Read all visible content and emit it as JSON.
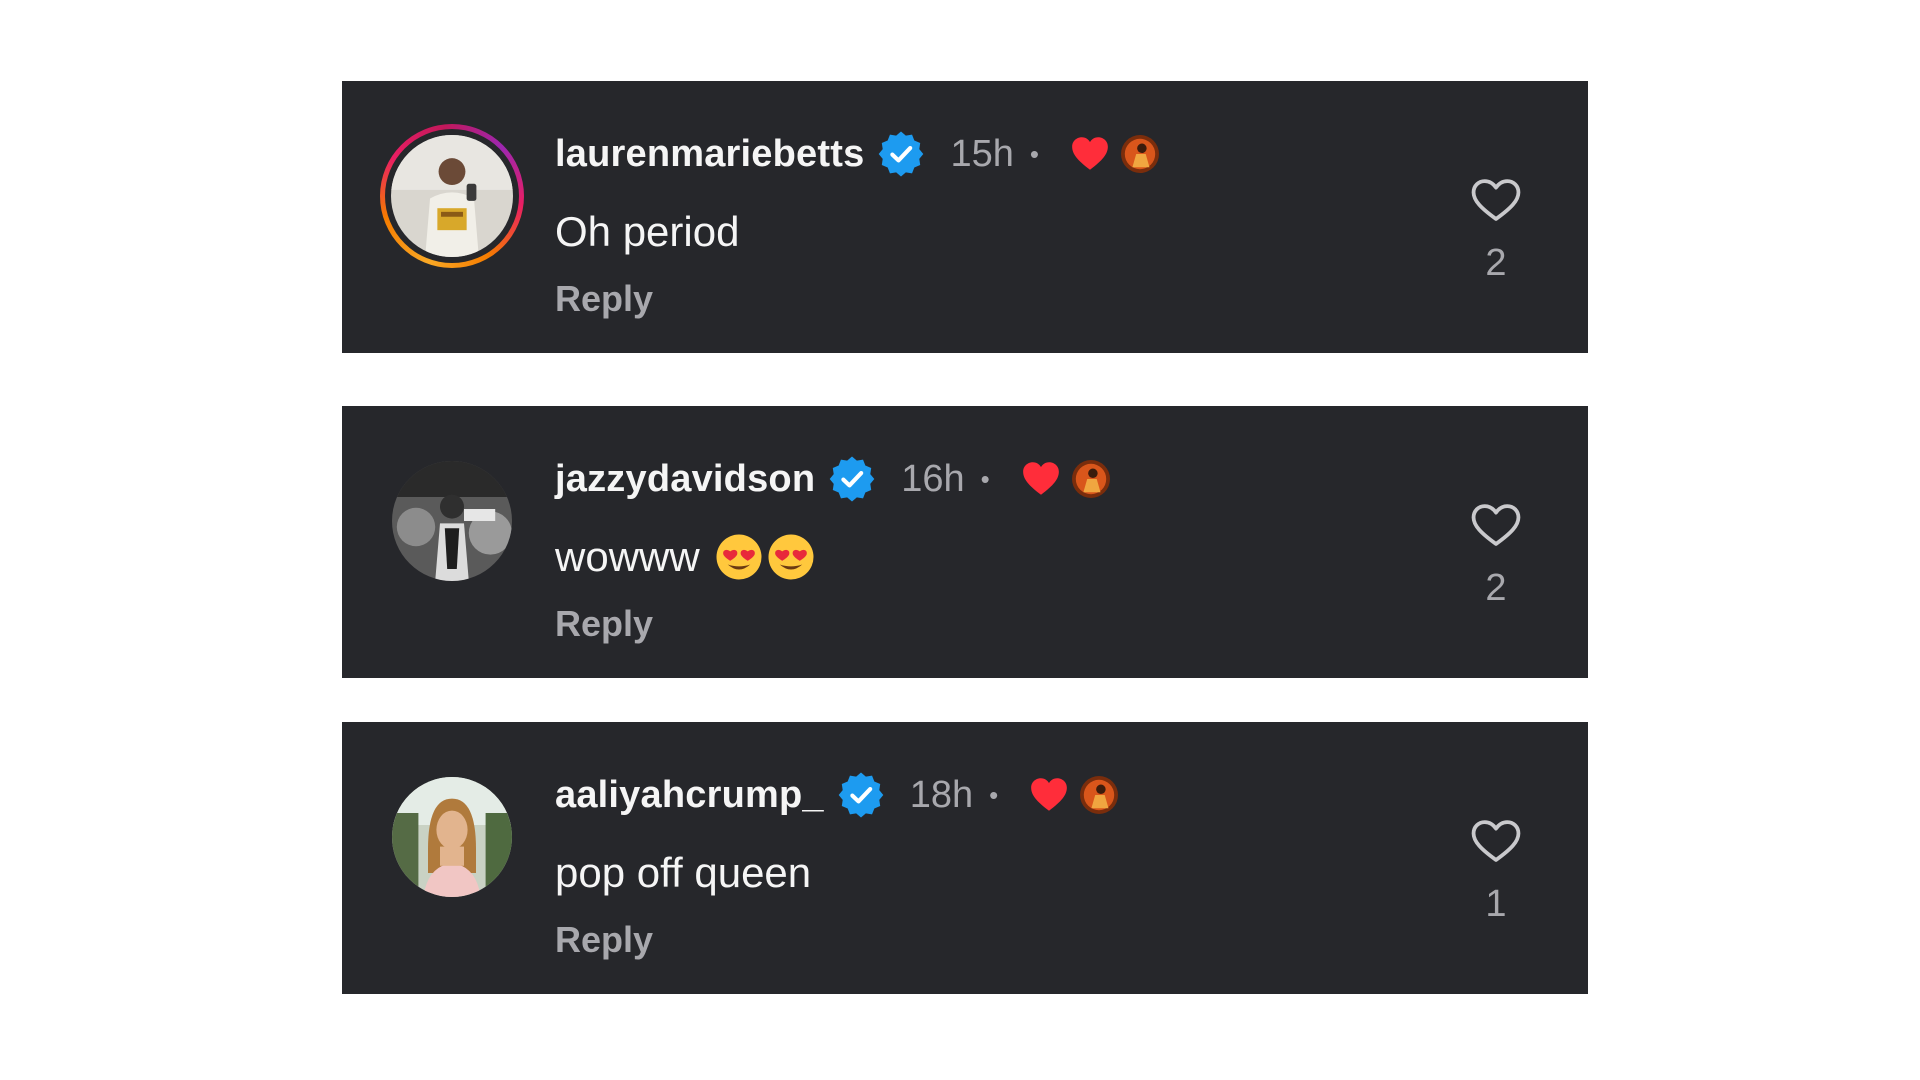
{
  "comments": [
    {
      "username": "laurenmariebetts",
      "timestamp": "15h",
      "separator": "•",
      "text": "Oh period",
      "emojis": [],
      "reply_label": "Reply",
      "like_count": "2",
      "has_story_ring": true,
      "verified": true,
      "liked_by_creator": true
    },
    {
      "username": "jazzydavidson",
      "timestamp": "16h",
      "separator": "•",
      "text": "wowww",
      "emojis": [
        "heart-eyes-emoji",
        "heart-eyes-emoji"
      ],
      "reply_label": "Reply",
      "like_count": "2",
      "has_story_ring": false,
      "verified": true,
      "liked_by_creator": true
    },
    {
      "username": "aaliyahcrump_",
      "timestamp": "18h",
      "separator": "•",
      "text": "pop off queen",
      "emojis": [],
      "reply_label": "Reply",
      "like_count": "1",
      "has_story_ring": false,
      "verified": true,
      "liked_by_creator": true
    }
  ],
  "icons": {
    "verified": "verified-badge-icon",
    "creator_heart": "creator-liked-heart-icon",
    "like": "like-heart-outline-icon"
  },
  "colors": {
    "card_background": "#26272b",
    "page_background": "#ffffff",
    "primary_text": "#f5f5f5",
    "secondary_text": "#a8a8ad",
    "verified_blue": "#1d9bf0",
    "creator_heart_red": "#ff2d3a"
  }
}
